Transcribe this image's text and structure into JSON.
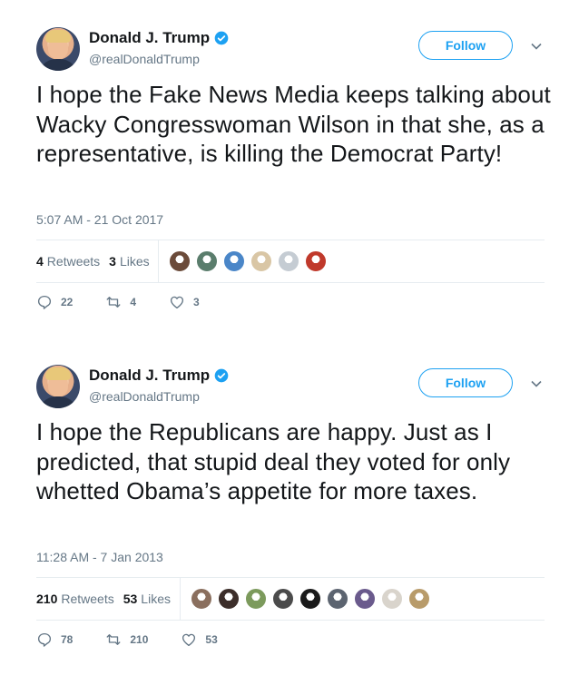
{
  "tweets": [
    {
      "author": {
        "name": "Donald J. Trump",
        "handle": "@realDonaldTrump",
        "verified": true
      },
      "follow_label": "Follow",
      "text": "I hope the Fake News Media keeps talking about Wacky Congresswoman Wilson in that she, as a representative, is killing the Democrat Party!",
      "timestamp": "5:07 AM - 21 Oct 2017",
      "stats": {
        "retweets_count": "4",
        "retweets_label": "Retweets",
        "likes_count": "3",
        "likes_label": "Likes"
      },
      "liker_colors": [
        "#6b4b3a",
        "#5a7d6c",
        "#4a86c8",
        "#d9c6a5",
        "#c5ccd3",
        "#c0392b"
      ],
      "actions": {
        "replies": "22",
        "retweets": "4",
        "likes": "3"
      }
    },
    {
      "author": {
        "name": "Donald J. Trump",
        "handle": "@realDonaldTrump",
        "verified": true
      },
      "follow_label": "Follow",
      "text": "I hope the Republicans are happy.  Just as I predicted, that stupid deal they voted for only whetted Obama’s appetite for more taxes.",
      "timestamp": "11:28 AM - 7 Jan 2013",
      "stats": {
        "retweets_count": "210",
        "retweets_label": "Retweets",
        "likes_count": "53",
        "likes_label": "Likes"
      },
      "liker_colors": [
        "#8a6f5e",
        "#3c2e2a",
        "#7c9a5c",
        "#4b4b4b",
        "#1a1a1a",
        "#5c6470",
        "#6a5a8c",
        "#d9d4cc",
        "#b89b6a"
      ],
      "actions": {
        "replies": "78",
        "retweets": "210",
        "likes": "53"
      }
    }
  ],
  "colors": {
    "brand": "#1da1f2",
    "text": "#14171a",
    "muted": "#657786",
    "divider": "#e6ecf0"
  }
}
